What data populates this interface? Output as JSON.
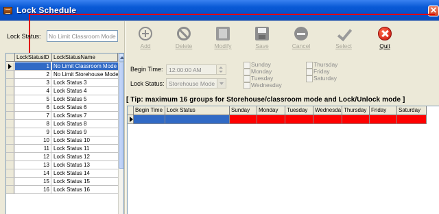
{
  "window": {
    "title": "Lock Schedule",
    "close_label": "✕"
  },
  "filter": {
    "label": "Lock Status:",
    "value": "No Limit Classroom Mode"
  },
  "left_grid": {
    "columns": [
      "LockStatusID",
      "LockStatusName"
    ],
    "rows": [
      {
        "id": "1",
        "name": "No Limit Classroom Mode"
      },
      {
        "id": "2",
        "name": "No Limit Storehouse Mode"
      },
      {
        "id": "3",
        "name": "Lock Status 3"
      },
      {
        "id": "4",
        "name": "Lock Status 4"
      },
      {
        "id": "5",
        "name": "Lock Status 5"
      },
      {
        "id": "6",
        "name": "Lock Status 6"
      },
      {
        "id": "7",
        "name": "Lock Status 7"
      },
      {
        "id": "8",
        "name": "Lock Status 8"
      },
      {
        "id": "9",
        "name": "Lock Status 9"
      },
      {
        "id": "10",
        "name": "Lock Status 10"
      },
      {
        "id": "11",
        "name": "Lock Status 11"
      },
      {
        "id": "12",
        "name": "Lock Status 12"
      },
      {
        "id": "13",
        "name": "Lock Status 13"
      },
      {
        "id": "14",
        "name": "Lock Status 14"
      },
      {
        "id": "15",
        "name": "Lock Status 15"
      },
      {
        "id": "16",
        "name": "Lock Status 16"
      }
    ]
  },
  "toolbar": {
    "add": "Add",
    "delete": "Delete",
    "modify": "Modify",
    "save": "Save",
    "cancel": "Cancel",
    "select": "Select",
    "quit": "Quit"
  },
  "settings": {
    "begin_time_label": "Begin Time:",
    "begin_time_value": "12:00:00 AM",
    "lock_status_label": "Lock Status:",
    "lock_status_value": "Storehouse Mode",
    "days": {
      "sunday": "Sunday",
      "monday": "Monday",
      "tuesday": "Tuesday",
      "wednesday": "Wednesday",
      "thursday": "Thursday",
      "friday": "Friday",
      "saturday": "Saturday"
    }
  },
  "tip": "[ Tip: maximum 16 groups for Storehouse/classroom mode and Lock/Unlock mode ]",
  "right_grid": {
    "columns": [
      "Begin Time",
      "Lock Status",
      "Sunday",
      "Monday",
      "Tuesday",
      "Wednesda",
      "Thursday",
      "Friday",
      "Saturday"
    ]
  },
  "colors": {
    "selection": "#316ac5",
    "day_cells": "#ff0000",
    "callout": "#e00000"
  }
}
